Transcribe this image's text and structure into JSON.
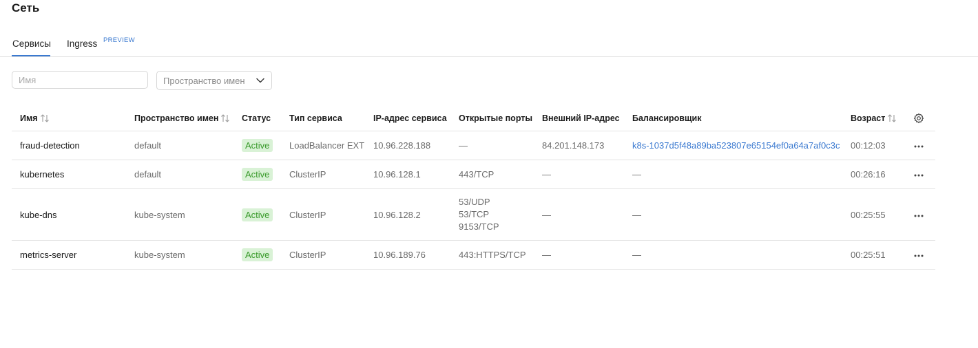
{
  "page": {
    "title": "Сеть"
  },
  "tabs": [
    {
      "label": "Сервисы",
      "active": true
    },
    {
      "label": "Ingress",
      "badge": "PREVIEW",
      "active": false
    }
  ],
  "filters": {
    "name_placeholder": "Имя",
    "namespace_label": "Пространство имен"
  },
  "colors": {
    "accent": "#3a79d0",
    "status_bg": "#d9f2d6",
    "status_text": "#3a9b2c"
  },
  "table": {
    "headers": {
      "name": "Имя",
      "namespace": "Пространство имен",
      "status": "Статус",
      "type": "Тип сервиса",
      "ip": "IP-адрес сервиса",
      "ports": "Открытые порты",
      "external_ip": "Внешний IP-адрес",
      "balancer": "Балансировщик",
      "age": "Возраст"
    },
    "rows": [
      {
        "name": "fraud-detection",
        "namespace": "default",
        "status": "Active",
        "type": "LoadBalancer EXT",
        "ip": "10.96.228.188",
        "ports": [
          "—"
        ],
        "external_ip": "84.201.148.173",
        "balancer": "k8s-1037d5f48a89ba523807e65154ef0a64a7af0c3c",
        "age": "00:12:03"
      },
      {
        "name": "kubernetes",
        "namespace": "default",
        "status": "Active",
        "type": "ClusterIP",
        "ip": "10.96.128.1",
        "ports": [
          "443/TCP"
        ],
        "external_ip": "—",
        "balancer": "—",
        "age": "00:26:16"
      },
      {
        "name": "kube-dns",
        "namespace": "kube-system",
        "status": "Active",
        "type": "ClusterIP",
        "ip": "10.96.128.2",
        "ports": [
          "53/UDP",
          "53/TCP",
          "9153/TCP"
        ],
        "external_ip": "—",
        "balancer": "—",
        "age": "00:25:55"
      },
      {
        "name": "metrics-server",
        "namespace": "kube-system",
        "status": "Active",
        "type": "ClusterIP",
        "ip": "10.96.189.76",
        "ports": [
          "443:HTTPS/TCP"
        ],
        "external_ip": "—",
        "balancer": "—",
        "age": "00:25:51"
      }
    ]
  }
}
